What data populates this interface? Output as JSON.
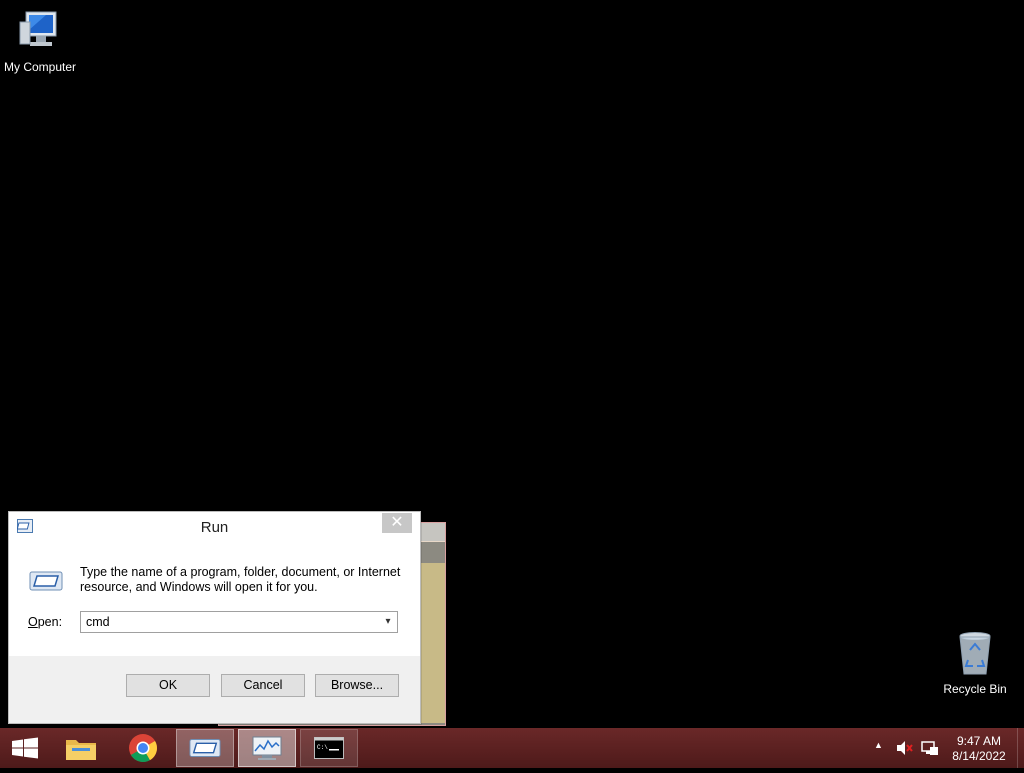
{
  "desktop": {
    "my_computer_label": "My Computer",
    "recycle_bin_label": "Recycle Bin"
  },
  "run_dialog": {
    "title": "Run",
    "close_glyph": "✕",
    "description": "Type the name of a program, folder, document, or Internet resource, and Windows will open it for you.",
    "open_label_prefix": "",
    "open_label_underlined": "O",
    "open_label_rest": "pen:",
    "open_value": "cmd",
    "ok_label": "OK",
    "cancel_label": "Cancel",
    "browse_label": "Browse..."
  },
  "taskbar": {
    "items": [
      {
        "name": "file-explorer",
        "icon": "folder-icon"
      },
      {
        "name": "chrome",
        "icon": "chrome-icon"
      },
      {
        "name": "run",
        "icon": "run-icon"
      },
      {
        "name": "resource-monitor",
        "icon": "resource-monitor-icon"
      },
      {
        "name": "command-prompt",
        "icon": "cmd-icon"
      }
    ],
    "clock_time": "9:47 AM",
    "clock_date": "8/14/2022"
  },
  "colors": {
    "taskbar": "#5a1f1f",
    "desktop": "#000000"
  }
}
